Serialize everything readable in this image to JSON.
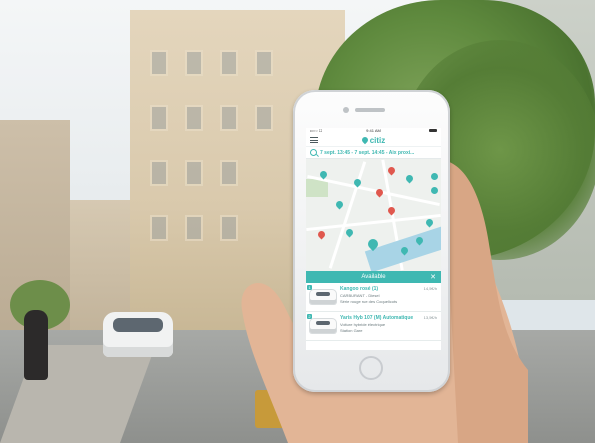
{
  "status_bar": {
    "carrier": "••○○ ☐",
    "time": "9:41 AM"
  },
  "app": {
    "brand": "citiz",
    "search_text": "7 sept. 13:45 - 7 sept. 14:45 - Aix proxi..."
  },
  "panel": {
    "title": "Available",
    "items": [
      {
        "index": "1",
        "title": "Kangoo rosé (1)",
        "subtitle": "CARBURANT - Diesel",
        "detail": "Série rouge rue des Coquelicots",
        "side": "14,5€/h"
      },
      {
        "index": "2",
        "title": "Yaris Hyb 107 (M) Automatique",
        "subtitle": "Voiture hybride électrique",
        "detail": "Station Gare",
        "side": "13,5€/h"
      }
    ]
  },
  "icons": [
    "menu-icon",
    "search-icon",
    "close-icon",
    "location-pin-icon",
    "layers-icon",
    "home-button"
  ],
  "colors": {
    "accent": "#3fb8b2",
    "marker_red": "#e0584e"
  }
}
